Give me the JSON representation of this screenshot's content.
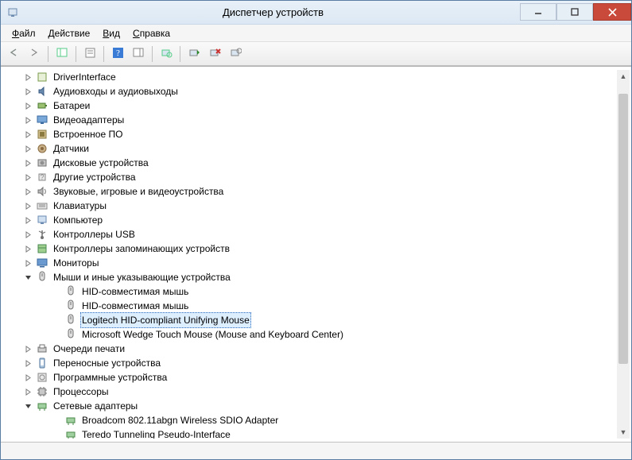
{
  "window": {
    "title": "Диспетчер устройств"
  },
  "menubar": {
    "file": "Файл",
    "action": "Действие",
    "view": "Вид",
    "help": "Справка"
  },
  "tree": [
    {
      "level": 1,
      "expand": "closed",
      "icon": "driver",
      "label": "DriverInterface"
    },
    {
      "level": 1,
      "expand": "closed",
      "icon": "audio",
      "label": "Аудиовходы и аудиовыходы"
    },
    {
      "level": 1,
      "expand": "closed",
      "icon": "battery",
      "label": "Батареи"
    },
    {
      "level": 1,
      "expand": "closed",
      "icon": "display",
      "label": "Видеоадаптеры"
    },
    {
      "level": 1,
      "expand": "closed",
      "icon": "firmware",
      "label": "Встроенное ПО"
    },
    {
      "level": 1,
      "expand": "closed",
      "icon": "sensor",
      "label": "Датчики"
    },
    {
      "level": 1,
      "expand": "closed",
      "icon": "disk",
      "label": "Дисковые устройства"
    },
    {
      "level": 1,
      "expand": "closed",
      "icon": "other",
      "label": "Другие устройства"
    },
    {
      "level": 1,
      "expand": "closed",
      "icon": "sound",
      "label": "Звуковые, игровые и видеоустройства"
    },
    {
      "level": 1,
      "expand": "closed",
      "icon": "keyboard",
      "label": "Клавиатуры"
    },
    {
      "level": 1,
      "expand": "closed",
      "icon": "computer",
      "label": "Компьютер"
    },
    {
      "level": 1,
      "expand": "closed",
      "icon": "usb",
      "label": "Контроллеры USB"
    },
    {
      "level": 1,
      "expand": "closed",
      "icon": "storage",
      "label": "Контроллеры запоминающих устройств"
    },
    {
      "level": 1,
      "expand": "closed",
      "icon": "monitor",
      "label": "Мониторы"
    },
    {
      "level": 1,
      "expand": "open",
      "icon": "mouse",
      "label": "Мыши и иные указывающие устройства"
    },
    {
      "level": 2,
      "expand": "none",
      "icon": "mouse",
      "label": "HID-совместимая мышь"
    },
    {
      "level": 2,
      "expand": "none",
      "icon": "mouse",
      "label": "HID-совместимая мышь"
    },
    {
      "level": 2,
      "expand": "none",
      "icon": "mouse",
      "label": "Logitech HID-compliant Unifying Mouse",
      "selected": true
    },
    {
      "level": 2,
      "expand": "none",
      "icon": "mouse",
      "label": "Microsoft Wedge Touch Mouse (Mouse and Keyboard Center)"
    },
    {
      "level": 1,
      "expand": "closed",
      "icon": "printq",
      "label": "Очереди печати"
    },
    {
      "level": 1,
      "expand": "closed",
      "icon": "portable",
      "label": "Переносные устройства"
    },
    {
      "level": 1,
      "expand": "closed",
      "icon": "software",
      "label": "Программные устройства"
    },
    {
      "level": 1,
      "expand": "closed",
      "icon": "cpu",
      "label": "Процессоры"
    },
    {
      "level": 1,
      "expand": "open",
      "icon": "network",
      "label": "Сетевые адаптеры"
    },
    {
      "level": 2,
      "expand": "none",
      "icon": "network",
      "label": "Broadcom 802.11abgn Wireless SDIO Adapter"
    },
    {
      "level": 2,
      "expand": "none",
      "icon": "network",
      "label": "Teredo Tunneling Pseudo-Interface"
    }
  ]
}
